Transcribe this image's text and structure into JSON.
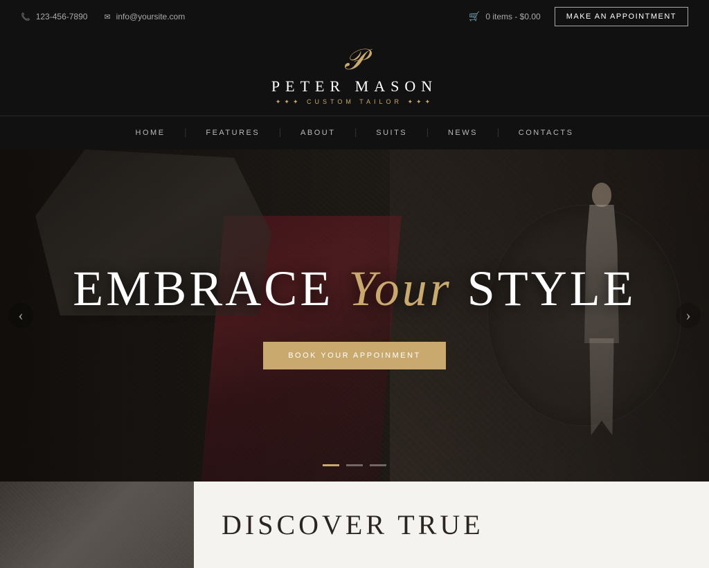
{
  "topbar": {
    "phone": "123-456-7890",
    "email": "info@yoursite.com",
    "cart": "0 items - $0.00",
    "appointment_btn": "MAKE AN APPOINTMENT"
  },
  "logo": {
    "monogram": "𝒫",
    "name": "PETER MASON",
    "subtitle": "✦✦✦  CUSTOM TAILOR  ✦✦✦"
  },
  "nav": {
    "items": [
      {
        "label": "HOME"
      },
      {
        "label": "FEATURES"
      },
      {
        "label": "ABOUT"
      },
      {
        "label": "SUITS"
      },
      {
        "label": "NEWS"
      },
      {
        "label": "CONTACTS"
      }
    ]
  },
  "hero": {
    "line1": "EMBRACE ",
    "italic": "Your",
    "line2": " STYLE",
    "cta": "BOOK YOUR APPOINMENT"
  },
  "slider": {
    "left_arrow": "‹",
    "right_arrow": "›"
  },
  "bottom": {
    "discover_line1": "DISCOVER TRUE"
  }
}
